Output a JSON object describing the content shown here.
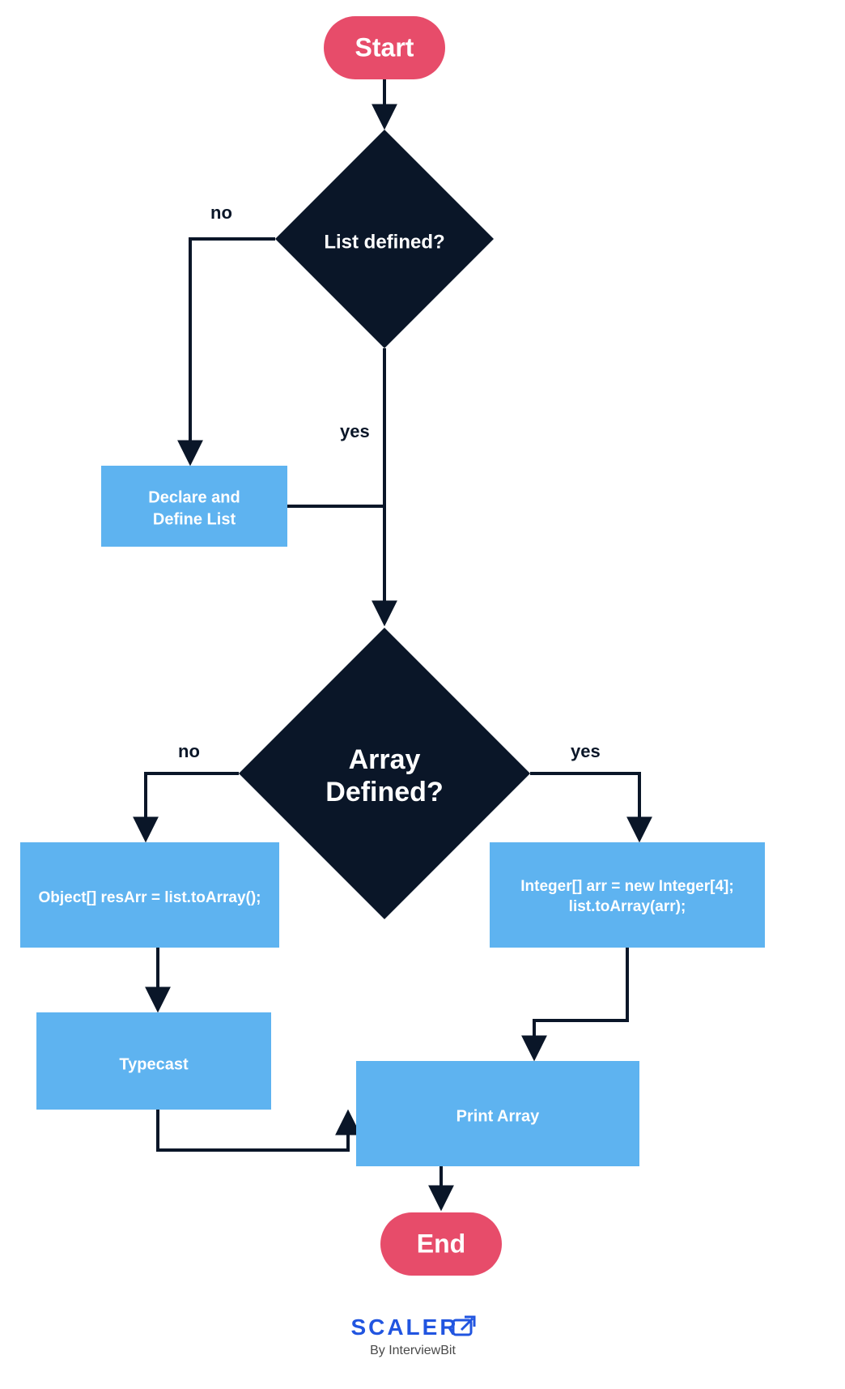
{
  "nodes": {
    "start": "Start",
    "decision1": "List defined?",
    "declare": {
      "line1": "Declare and",
      "line2": "Define List"
    },
    "decision2": {
      "line1": "Array",
      "line2": "Defined?"
    },
    "objArr": "Object[] resArr = list.toArray();",
    "intArr": {
      "line1": "Integer[] arr = new Integer[4];",
      "line2": "list.toArray(arr);"
    },
    "typecast": "Typecast",
    "print": "Print Array",
    "end": "End"
  },
  "edges": {
    "no": "no",
    "yes": "yes"
  },
  "footer": {
    "brand": "SCALER",
    "sub": "By InterviewBit"
  }
}
